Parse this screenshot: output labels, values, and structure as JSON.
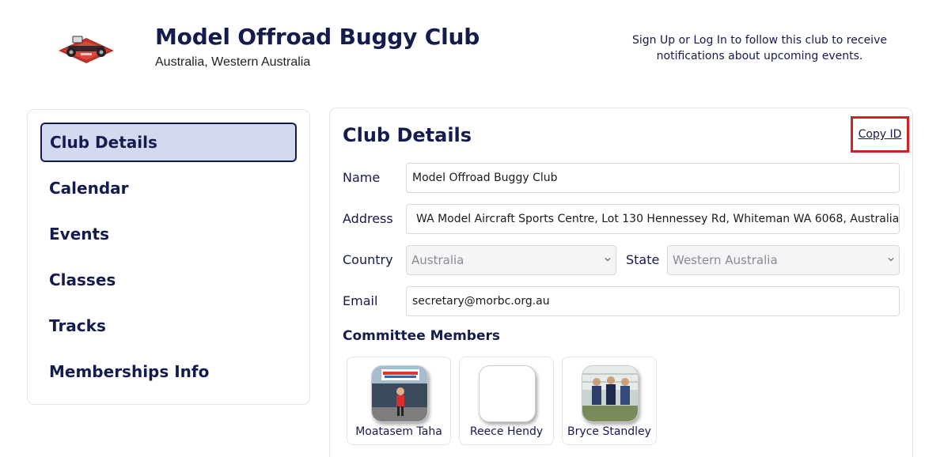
{
  "header": {
    "club_name": "Model Offroad Buggy Club",
    "location": "Australia, Western Australia",
    "follow_note": "Sign Up or Log In to follow this club to receive notifications about upcoming events."
  },
  "sidebar": {
    "items": [
      {
        "label": "Club Details",
        "active": true
      },
      {
        "label": "Calendar"
      },
      {
        "label": "Events"
      },
      {
        "label": "Classes"
      },
      {
        "label": "Tracks"
      },
      {
        "label": "Memberships Info"
      }
    ]
  },
  "details": {
    "title": "Club Details",
    "copy_id_label": "Copy ID",
    "name_label": "Name",
    "name_value": "Model Offroad Buggy Club",
    "address_label": "Address",
    "address_value": "WA Model Aircraft Sports Centre, Lot 130 Hennessey Rd, Whiteman WA 6068, Australia",
    "country_label": "Country",
    "country_value": "Australia",
    "state_label": "State",
    "state_value": "Western Australia",
    "email_label": "Email",
    "email_value": "secretary@morbc.org.au"
  },
  "committee": {
    "title": "Committee Members",
    "members": [
      {
        "name": "Moatasem Taha"
      },
      {
        "name": "Reece Hendy"
      },
      {
        "name": "Bryce Standley"
      }
    ]
  },
  "colors": {
    "brand_navy": "#141b4d",
    "active_bg": "#d3daef",
    "highlight_red": "#d51f26"
  }
}
